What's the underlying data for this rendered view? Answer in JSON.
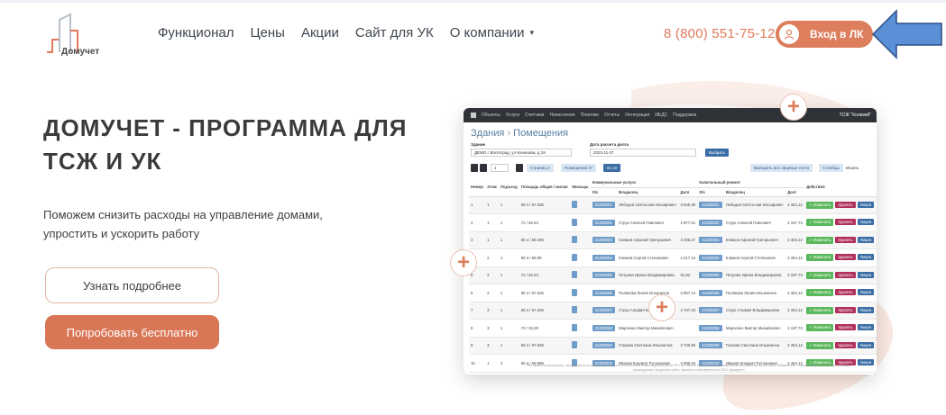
{
  "header": {
    "logo_text": "Домучет",
    "nav": [
      "Функционал",
      "Цены",
      "Акции",
      "Сайт для УК",
      "О компании"
    ],
    "nav_dropdown_caret": "▾",
    "phone": "8 (800) 551-75-12",
    "login_label": "Вход в ЛК"
  },
  "hero": {
    "title": "ДОМУЧЕТ - ПРОГРАММА ДЛЯ ТСЖ И УК",
    "subtitle": "Поможем снизить расходы на управление домами, упростить и ускорить работу",
    "btn_more": "Узнать подробнее",
    "btn_try": "Попробовать бесплатно"
  },
  "colors": {
    "accent": "#dd7e5d",
    "arrow": "#5b8fd6",
    "text": "#3b3b3b"
  },
  "mock": {
    "menu": [
      "Объекты",
      "Услуги",
      "Счетчики",
      "Начисления",
      "Платежи",
      "Отчеты",
      "Интеграция",
      "ИЕДС",
      "Поддержка"
    ],
    "menu_right": "ТСЖ \"Колизей\"",
    "title": "Здания",
    "title_sep": "›",
    "title_sub": "Помещения",
    "label_building": "Здание",
    "building_value": "ДЕМО г Волгоград, ул Кононова, д 19",
    "label_date": "Дата расчета долга",
    "date_value": "2023-11-27",
    "btn_select": "Выбрать",
    "page_value": "1",
    "pages_label": "Страниц 3",
    "rooms_label": "Помещений 27",
    "per_page": "по 10",
    "btn_show_all": "Выводить все лицевые счета",
    "btn_columns": "Столбцы",
    "search_label": "Искать",
    "headers": [
      "Номер",
      "Этаж",
      "Подъезд",
      "Площадь общая / жилая",
      "Жильцы",
      "Коммунальные услуги",
      "Капитальный ремонт",
      "Действия"
    ],
    "subheaders": [
      "Л/с",
      "Владелец",
      "Долг",
      "Л/с",
      "Владелец",
      "Долг"
    ],
    "rows": [
      {
        "num": "1",
        "floor": "1",
        "ent": "1",
        "area": "80.4 / 67.536",
        "ls1": "31330001",
        "owner1": "Лебедев Святослав Иосифович",
        "debt1": "3 645,39",
        "ls2": "31330001",
        "owner2": "Лебедев Святослав Иосифович",
        "debt2": "2 454,12"
      },
      {
        "num": "2",
        "floor": "1",
        "ent": "1",
        "area": "72 / 62.64",
        "ls1": "31330002",
        "owner1": "Струк Алексей Павлович",
        "debt1": "2 877,21",
        "ls2": "31330002",
        "owner2": "Струк Алексей Павлович",
        "debt2": "2 197,73"
      },
      {
        "num": "3",
        "floor": "1",
        "ent": "1",
        "area": "80.4 / 59.406",
        "ls1": "31330003",
        "owner1": "Климов Афоний Григорьевич",
        "debt1": "3 306,27",
        "ls2": "31330003",
        "owner2": "Климов Афоний Григорьевич",
        "debt2": "2 454,12"
      },
      {
        "num": "4",
        "floor": "2",
        "ent": "1",
        "area": "80.4 / 69.99",
        "ls1": "31330004",
        "owner1": "Климов Сергей Степанович",
        "debt1": "2 217,15",
        "ls2": "31330004",
        "owner2": "Климов Сергей Степанович",
        "debt2": "2 454,12"
      },
      {
        "num": "5",
        "floor": "2",
        "ent": "1",
        "area": "72 / 62.64",
        "ls1": "31330005",
        "owner1": "Петрова Ирина Владимировна",
        "debt1": "91,82",
        "ls2": "31330005",
        "owner2": "Петрова Ирина Владимировна",
        "debt2": "2 197,73"
      },
      {
        "num": "6",
        "floor": "2",
        "ent": "1",
        "area": "80.4 / 67.536",
        "ls1": "31330006",
        "owner1": "Полякова Лилия Ильинична",
        "debt1": "2 857,14",
        "ls2": "31330006",
        "owner2": "Полякова Лилия Ильинична",
        "debt2": "2 454,12"
      },
      {
        "num": "7",
        "floor": "3",
        "ent": "1",
        "area": "80.4 / 67.536",
        "ls1": "31330007",
        "owner1": "Струк Альфия Владимировна",
        "debt1": "2 767,33",
        "ls2": "31330007",
        "owner2": "Струк Альфия Владимировна",
        "debt2": "2 454,12"
      },
      {
        "num": "8",
        "floor": "3",
        "ent": "1",
        "area": "72 / 33.28",
        "ls1": "31330008",
        "owner1": "Марченко Виктор Михайлович",
        "debt1": "",
        "ls2": "31330008",
        "owner2": "Марченко Виктор Михайлович",
        "debt2": "2 197,73"
      },
      {
        "num": "9",
        "floor": "3",
        "ent": "1",
        "area": "80.4 / 67.536",
        "ls1": "31330009",
        "owner1": "Глазова Светлана Ильинична",
        "debt1": "2 740,86",
        "ls2": "31330009",
        "owner2": "Глазова Светлана Ильинична",
        "debt2": "2 454,12"
      },
      {
        "num": "10",
        "floor": "1",
        "ent": "2",
        "area": "80.4 / 69.996",
        "ls1": "31330010",
        "owner1": "Иванов Кондрат Русланович",
        "debt1": "2 980,04",
        "ls2": "31330010",
        "owner2": "Иванов Кондрат Русланович",
        "debt2": "2 454,12"
      }
    ],
    "act_edit": "✓ Изменить",
    "act_delete": "Удалить",
    "act_more": "Лицев",
    "footer": "Все права на материалы, находящиеся на сайте, охраняются в соответствии с законодательством РФ. При любом использовании материалов сайта ссылка на источник обязательна. Торговые марки, логотипы и товары, размещенные на данном сайте, являются собственностью ООО «Домучет»"
  },
  "plus_symbol": "+"
}
